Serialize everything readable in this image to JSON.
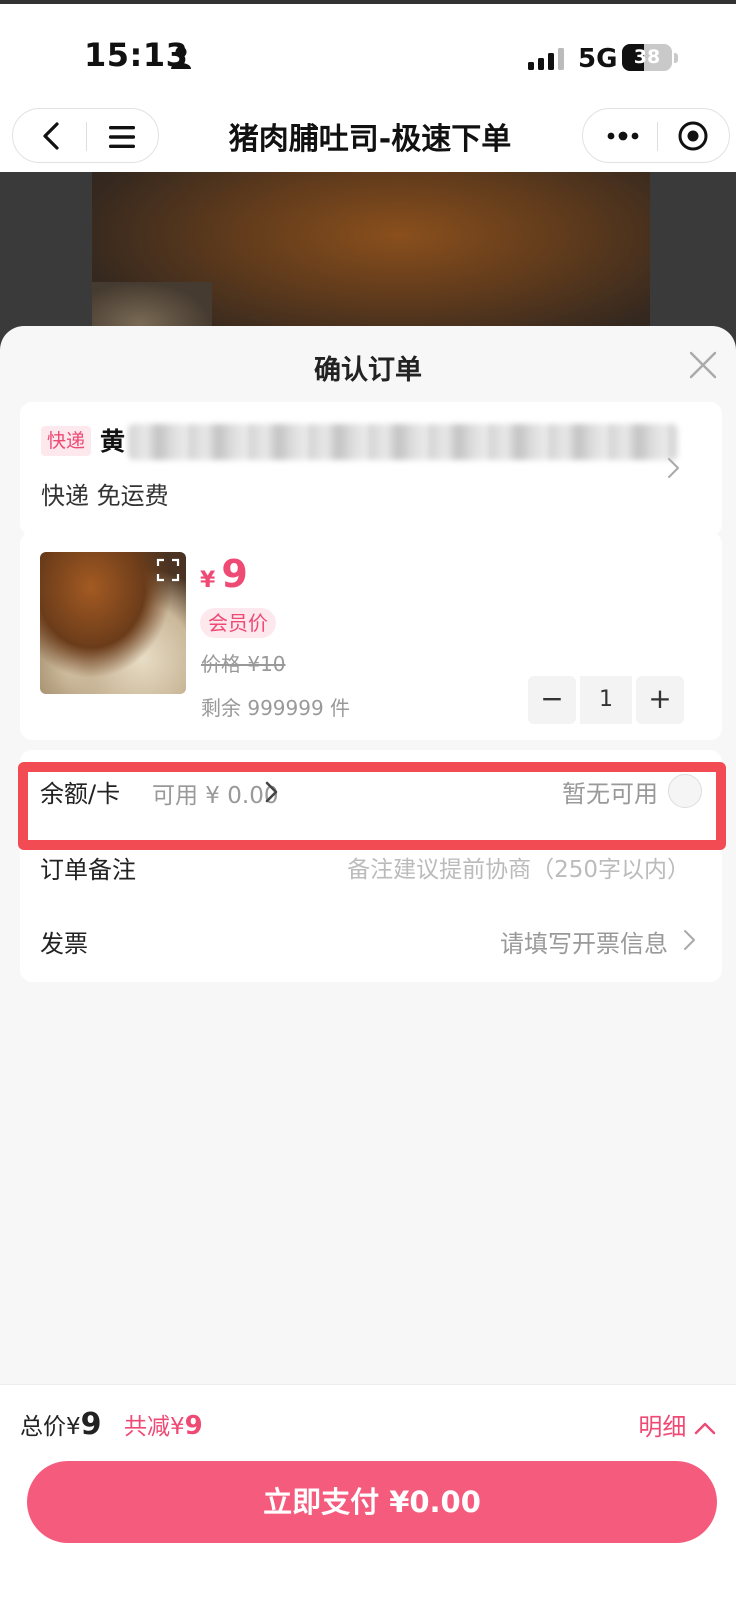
{
  "status_bar": {
    "time": "15:13",
    "network": "5G",
    "battery": "38"
  },
  "nav": {
    "title": "猪肉脯吐司-极速下单"
  },
  "sheet": {
    "title": "确认订单"
  },
  "address": {
    "delivery_tag": "快递",
    "name": "黄",
    "delivery_info": "快递 免运费"
  },
  "goods": {
    "price_symbol": "¥",
    "price": "9",
    "member_tag": "会员价",
    "original_price": "价格 ¥10",
    "stock": "剩余 999999 件",
    "quantity": "1",
    "minus": "−",
    "plus": "+"
  },
  "options": {
    "balance_label": "余额/卡",
    "balance_available": "可用 ¥ 0.00",
    "balance_status": "暂无可用",
    "remark_label": "订单备注",
    "remark_placeholder": "备注建议提前协商（250字以内）",
    "invoice_label": "发票",
    "invoice_value": "请填写开票信息"
  },
  "footer": {
    "total_label": "总价",
    "total_symbol": "¥",
    "total_amount": "9",
    "discount_label": "共减",
    "discount_symbol": "¥",
    "discount_amount": "9",
    "detail_label": "明细",
    "pay_label": "立即支付",
    "pay_amount": "¥0.00"
  },
  "colors": {
    "accent": "#ee4a74",
    "pay_button": "#f55b7d",
    "highlight": "#f24b54"
  }
}
